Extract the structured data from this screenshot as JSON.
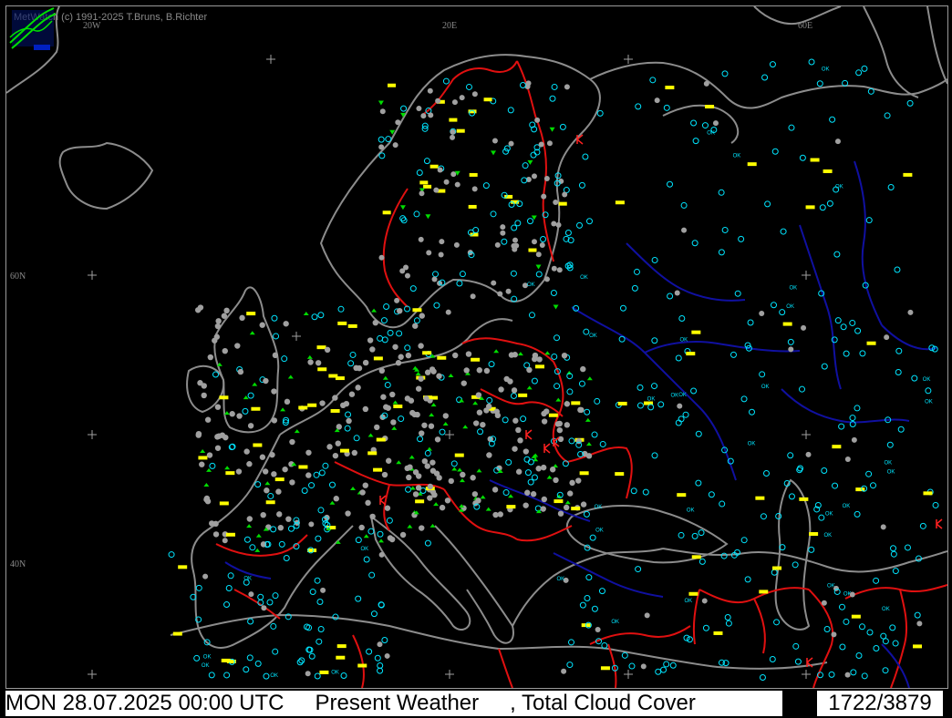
{
  "app": {
    "credit": "MetWatch  (c) 1991-2025 T.Bruns, B.Richter"
  },
  "grid_labels": {
    "lon_20w": "20W",
    "lon_20e": "20E",
    "lon_60e": "60E",
    "lat_60n": "60N",
    "lat_40n": "40N"
  },
  "status_bar": {
    "datetime": "MON 28.07.2025 00:00 UTC",
    "parameter_1": "Present Weather",
    "parameter_2": ", Total Cloud Cover",
    "station_count": "1722/3879"
  },
  "colors": {
    "background": "#000000",
    "coastline": "#8c8c8c",
    "borders": "#e01010",
    "rivers": "#1010a0",
    "cloud_symbol": "#00e5ff",
    "fog_symbol": "#ffff00",
    "rain_symbol": "#00dd00",
    "thunder_symbol": "#ff2020",
    "station_gray": "#a0a0a0"
  },
  "symbol_text": {
    "ok": "OK"
  },
  "icons": {
    "logo": "metwatch-logo-icon",
    "graticule": "cross-icon"
  }
}
